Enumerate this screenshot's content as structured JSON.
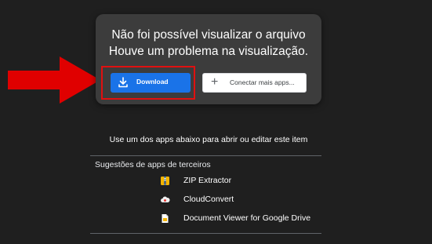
{
  "error": {
    "title_line1": "Não foi possível visualizar o arquivo",
    "title_line2": "Houve um problema na visualização."
  },
  "actions": {
    "download_label": "Download",
    "connect_label": "Conectar mais apps..."
  },
  "apps": {
    "instruction": "Use um dos apps abaixo para abrir ou editar este item",
    "section_heading": "Sugestões de apps de terceiros",
    "items": [
      {
        "name": "ZIP Extractor",
        "icon": "zip-extractor-icon"
      },
      {
        "name": "CloudConvert",
        "icon": "cloudconvert-icon"
      },
      {
        "name": "Document Viewer for Google Drive",
        "icon": "document-viewer-icon"
      }
    ]
  },
  "colors": {
    "background": "#1f1f1f",
    "card": "#3c3c3c",
    "primary_button": "#1a73e8",
    "highlight": "#e01010"
  }
}
